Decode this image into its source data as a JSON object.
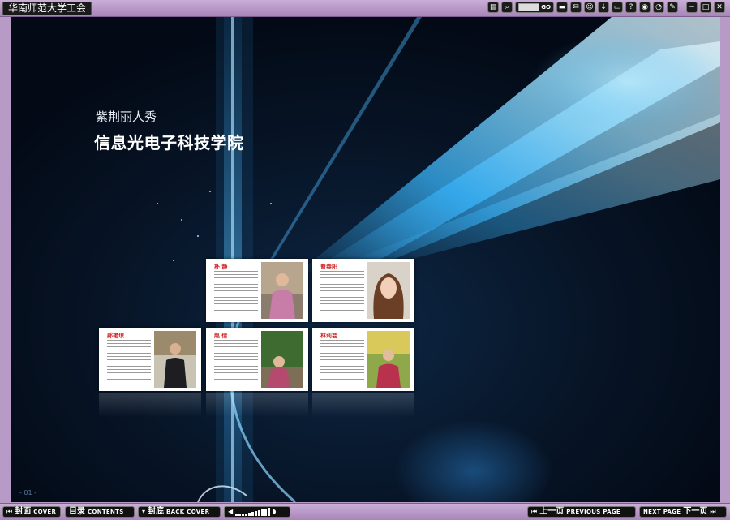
{
  "app": {
    "title": "华南师范大学工会"
  },
  "toolbar": {
    "icons": [
      "document-icon",
      "zoom-icon",
      "goto-page-field",
      "comment-icon",
      "share-icon",
      "user-icon",
      "download-icon",
      "print-icon",
      "help-icon",
      "settings-icon",
      "clock-icon",
      "tools-icon",
      "minimize-icon",
      "maximize-icon",
      "close-icon"
    ],
    "goto_label": "GO"
  },
  "cover": {
    "subtitle": "紫荆丽人秀",
    "title": "信息光电子科技学院",
    "page_number": "- 01 -"
  },
  "thumbnails": [
    {
      "name": "朴 静"
    },
    {
      "name": "曹春阳"
    },
    {
      "name": "郝艳琼"
    },
    {
      "name": "赵 倩"
    },
    {
      "name": "林莉芸"
    }
  ],
  "bottom": {
    "cover": {
      "zh": "封面",
      "en": "COVER"
    },
    "contents": {
      "zh": "目录",
      "en": "CONTENTS"
    },
    "back_cover": {
      "zh": "封底",
      "en": "BACK COVER"
    },
    "prev": {
      "zh": "上一页",
      "en": "PREVIOUS PAGE"
    },
    "next": {
      "en": "NEXT PAGE",
      "zh": "下一页"
    }
  },
  "colors": {
    "frame": "#b79ac6",
    "name_red": "#d21e1e",
    "beam": "#3ab8ff"
  }
}
